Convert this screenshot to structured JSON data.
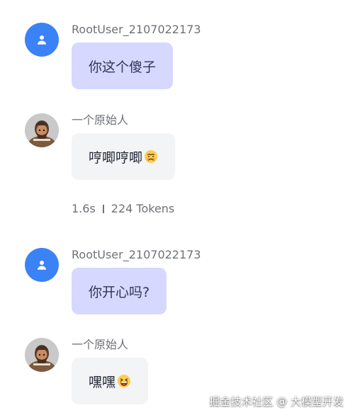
{
  "messages": [
    {
      "sender": "RootUser_2107022173",
      "text": "你这个傻子",
      "icon": "user-icon"
    },
    {
      "sender": "一个原始人",
      "text": "哼唧哼唧",
      "icon": "avatar-image",
      "emoji": "worried-face-emoji"
    },
    {
      "sender": "RootUser_2107022173",
      "text": "你开心吗?",
      "icon": "user-icon"
    },
    {
      "sender": "一个原始人",
      "text": "嘿嘿",
      "icon": "avatar-image",
      "emoji": "grinning-squinting-face-emoji"
    }
  ],
  "meta": {
    "time": "1.6s",
    "tokens": "224 Tokens"
  },
  "watermark": "掘金技术社区 @ 大模型开发",
  "colors": {
    "user_avatar": "#3b82f6",
    "user_bubble": "#d6d8ff",
    "bot_bubble": "#f3f4f6",
    "muted_text": "#6f7177"
  }
}
